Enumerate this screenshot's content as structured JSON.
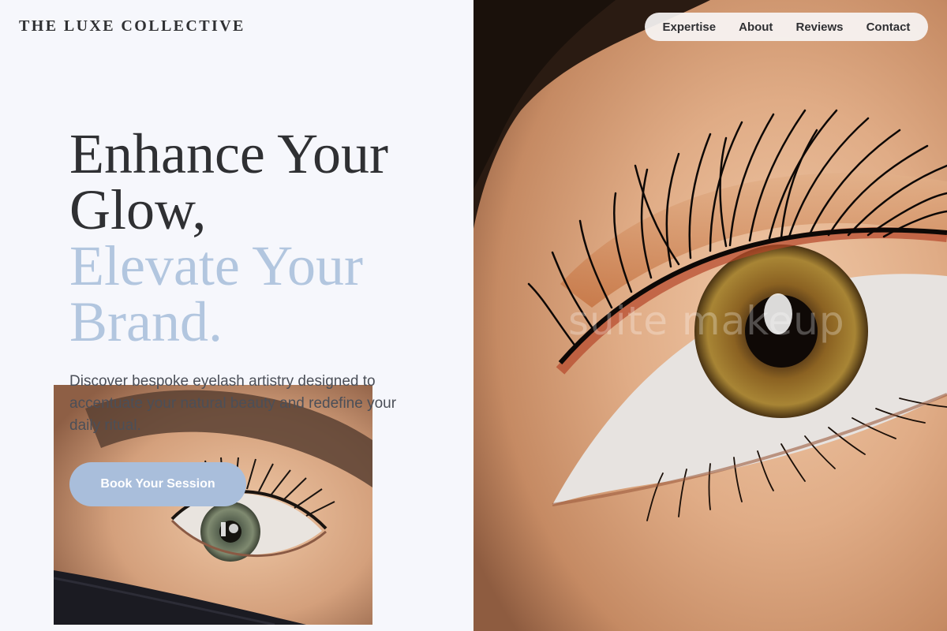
{
  "brand": {
    "name": "THE LUXE COLLECTIVE"
  },
  "nav": {
    "items": [
      {
        "label": "Expertise"
      },
      {
        "label": "About"
      },
      {
        "label": "Reviews"
      },
      {
        "label": "Contact"
      }
    ]
  },
  "hero": {
    "headline_line1": "Enhance Your",
    "headline_line2": "Glow,",
    "headline_accent1": "Elevate Your",
    "headline_accent2": "Brand.",
    "description": "Discover bespoke eyelash artistry designed to accentuate your natural beauty and redefine your daily ritual.",
    "cta_label": "Book Your Session"
  },
  "photo": {
    "watermark": "suite makeup"
  },
  "colors": {
    "background": "#f6f7fc",
    "text_dark": "#2f3033",
    "accent": "#b2c6df",
    "button": "#a9bedb"
  }
}
